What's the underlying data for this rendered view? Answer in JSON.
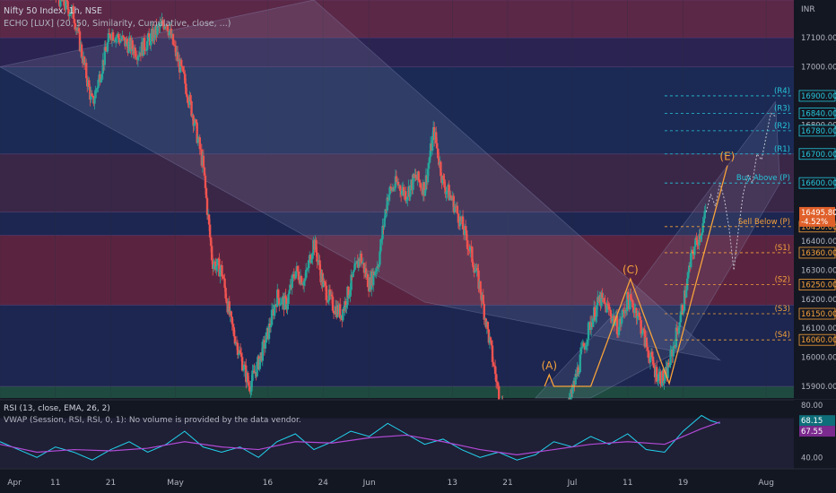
{
  "header": {
    "symbol_line": "Nifty 50 Index, 1h, NSE",
    "indicator_line": "ECHO [LUX] (20, 50, Similarity, Cumulative, close, ...)",
    "currency": "INR"
  },
  "rsi": {
    "title": "RSI (13, close, EMA, 26, 2)",
    "vwap_note": "VWAP (Session, RSI, RSI, 0, 1): No volume is provided by the data vendor.",
    "scale_labels": [
      "80.00",
      "40.00"
    ],
    "value_1": "68.15",
    "value_2": "67.55"
  },
  "colors": {
    "background": "#131722",
    "candle_up": "#26a69a",
    "candle_down": "#ef5350",
    "wave": "#f7a23b",
    "pivot_resistance": "#26c6da",
    "pivot_support": "#f7a23b",
    "rsi_line": "#22d3ee",
    "rsi_signal": "#b14ad6"
  },
  "chart_data": {
    "type": "candlestick",
    "title": "Nifty 50 Index, 1h, NSE",
    "ylim": [
      15860,
      17230
    ],
    "y_ticks": [
      17100,
      17000,
      16900,
      16800,
      16700,
      16600,
      16500,
      16400,
      16300,
      16200,
      16100,
      16000,
      15900
    ],
    "y_tick_labels": [
      "17100.00",
      "17000.00",
      "16900.00",
      "16800.00",
      "16700.00",
      "16600.00",
      "16500.00",
      "16400.00",
      "16300.00",
      "16200.00",
      "16100.00",
      "16000.00",
      "15900.00"
    ],
    "x_labels": [
      {
        "label": "Apr",
        "x": 0
      },
      {
        "label": "11",
        "x": 6
      },
      {
        "label": "21",
        "x": 12
      },
      {
        "label": "May",
        "x": 19
      },
      {
        "label": "16",
        "x": 29
      },
      {
        "label": "24",
        "x": 35
      },
      {
        "label": "Jun",
        "x": 40
      },
      {
        "label": "13",
        "x": 49
      },
      {
        "label": "21",
        "x": 55
      },
      {
        "label": "Jul",
        "x": 62
      },
      {
        "label": "11",
        "x": 68
      },
      {
        "label": "19",
        "x": 74
      },
      {
        "label": "Aug",
        "x": 83
      }
    ],
    "x_max": 86,
    "bands": [
      {
        "from": 17100,
        "to": 17230,
        "color": "#5b2848"
      },
      {
        "from": 17000,
        "to": 17100,
        "color": "#2b2452"
      },
      {
        "from": 16700,
        "to": 17000,
        "color": "#1b2a55"
      },
      {
        "from": 16500,
        "to": 16700,
        "color": "#3a2748"
      },
      {
        "from": 16420,
        "to": 16500,
        "color": "#1d2650"
      },
      {
        "from": 16180,
        "to": 16420,
        "color": "#5a2440"
      },
      {
        "from": 15900,
        "to": 16180,
        "color": "#1c2650"
      },
      {
        "from": 15860,
        "to": 15900,
        "color": "#1e4a40"
      }
    ],
    "price_series": [
      {
        "x": 0,
        "y": 17280
      },
      {
        "x": 3,
        "y": 17350
      },
      {
        "x": 6,
        "y": 17250
      },
      {
        "x": 8,
        "y": 17180
      },
      {
        "x": 10,
        "y": 16870
      },
      {
        "x": 12,
        "y": 17120
      },
      {
        "x": 15,
        "y": 17050
      },
      {
        "x": 18,
        "y": 17160
      },
      {
        "x": 19,
        "y": 17050
      },
      {
        "x": 20,
        "y": 16950
      },
      {
        "x": 21,
        "y": 16820
      },
      {
        "x": 22,
        "y": 16660
      },
      {
        "x": 23,
        "y": 16330
      },
      {
        "x": 24,
        "y": 16300
      },
      {
        "x": 25,
        "y": 16120
      },
      {
        "x": 26,
        "y": 16010
      },
      {
        "x": 27,
        "y": 15900
      },
      {
        "x": 28,
        "y": 15980
      },
      {
        "x": 29,
        "y": 16080
      },
      {
        "x": 30,
        "y": 16210
      },
      {
        "x": 31,
        "y": 16180
      },
      {
        "x": 32,
        "y": 16300
      },
      {
        "x": 33,
        "y": 16260
      },
      {
        "x": 34,
        "y": 16400
      },
      {
        "x": 35,
        "y": 16250
      },
      {
        "x": 36,
        "y": 16180
      },
      {
        "x": 37,
        "y": 16150
      },
      {
        "x": 38,
        "y": 16250
      },
      {
        "x": 39,
        "y": 16350
      },
      {
        "x": 40,
        "y": 16250
      },
      {
        "x": 41,
        "y": 16330
      },
      {
        "x": 42,
        "y": 16560
      },
      {
        "x": 43,
        "y": 16600
      },
      {
        "x": 44,
        "y": 16560
      },
      {
        "x": 45,
        "y": 16620
      },
      {
        "x": 46,
        "y": 16580
      },
      {
        "x": 47,
        "y": 16780
      },
      {
        "x": 48,
        "y": 16600
      },
      {
        "x": 49,
        "y": 16540
      },
      {
        "x": 50,
        "y": 16460
      },
      {
        "x": 51,
        "y": 16360
      },
      {
        "x": 52,
        "y": 16240
      },
      {
        "x": 53,
        "y": 16060
      },
      {
        "x": 54,
        "y": 15880
      },
      {
        "x": 55,
        "y": 15760
      },
      {
        "x": 56,
        "y": 15700
      },
      {
        "x": 57,
        "y": 15800
      },
      {
        "x": 58,
        "y": 15830
      },
      {
        "x": 59,
        "y": 15760
      },
      {
        "x": 60,
        "y": 15700
      },
      {
        "x": 61,
        "y": 15760
      },
      {
        "x": 62,
        "y": 15880
      },
      {
        "x": 63,
        "y": 16010
      },
      {
        "x": 64,
        "y": 16120
      },
      {
        "x": 65,
        "y": 16200
      },
      {
        "x": 66,
        "y": 16160
      },
      {
        "x": 67,
        "y": 16100
      },
      {
        "x": 68,
        "y": 16200
      },
      {
        "x": 69,
        "y": 16160
      },
      {
        "x": 70,
        "y": 16040
      },
      {
        "x": 71,
        "y": 15950
      },
      {
        "x": 72,
        "y": 15920
      },
      {
        "x": 73,
        "y": 16040
      },
      {
        "x": 74,
        "y": 16180
      },
      {
        "x": 75,
        "y": 16360
      },
      {
        "x": 76,
        "y": 16440
      },
      {
        "x": 76.5,
        "y": 16500
      }
    ],
    "echo_forecast": [
      {
        "x": 76.5,
        "y": 16500
      },
      {
        "x": 77,
        "y": 16560
      },
      {
        "x": 77.5,
        "y": 16520
      },
      {
        "x": 78,
        "y": 16600
      },
      {
        "x": 78.5,
        "y": 16540
      },
      {
        "x": 79,
        "y": 16440
      },
      {
        "x": 79.5,
        "y": 16300
      },
      {
        "x": 80,
        "y": 16440
      },
      {
        "x": 80.5,
        "y": 16560
      },
      {
        "x": 81,
        "y": 16630
      },
      {
        "x": 81.5,
        "y": 16600
      },
      {
        "x": 82,
        "y": 16700
      },
      {
        "x": 82.5,
        "y": 16680
      },
      {
        "x": 83,
        "y": 16760
      },
      {
        "x": 83.5,
        "y": 16840
      },
      {
        "x": 84,
        "y": 16830
      }
    ],
    "channels": [
      {
        "points": [
          [
            0,
            17000
          ],
          [
            46,
            16190
          ],
          [
            78,
            15990
          ],
          [
            34,
            17230
          ]
        ],
        "fill": "#9aa4c8",
        "opacity": 0.16
      },
      {
        "points": [
          [
            58,
            15860
          ],
          [
            68,
            16200
          ],
          [
            84,
            16880
          ],
          [
            84.5,
            16600
          ],
          [
            74,
            16030
          ],
          [
            64,
            15860
          ]
        ],
        "fill": "#9aa4c8",
        "opacity": 0.13
      }
    ],
    "wave_points": [
      {
        "x": 59,
        "y": 15900,
        "label": ""
      },
      {
        "x": 59.5,
        "y": 15940,
        "label": "(A)"
      },
      {
        "x": 60,
        "y": 15900,
        "label": ""
      },
      {
        "x": 64,
        "y": 15900,
        "label": ""
      },
      {
        "x": 68.3,
        "y": 16270,
        "label": "(C)"
      },
      {
        "x": 72.5,
        "y": 15910,
        "label": ""
      },
      {
        "x": 78.8,
        "y": 16660,
        "label": "(E)"
      }
    ],
    "pivot_lines": [
      {
        "label": "(R4)",
        "value": 16900,
        "value_label": "16900.00",
        "kind": "resistance"
      },
      {
        "label": "(R3)",
        "value": 16840,
        "value_label": "16840.00",
        "kind": "resistance"
      },
      {
        "label": "(R2)",
        "value": 16780,
        "value_label": "16780.00",
        "kind": "resistance"
      },
      {
        "label": "(R1)",
        "value": 16700,
        "value_label": "16700.00",
        "kind": "resistance"
      },
      {
        "label": "Buy Above (P)",
        "value": 16600,
        "value_label": "16600.00",
        "kind": "resistance"
      },
      {
        "label": "Sell Below (P)",
        "value": 16450,
        "value_label": "16450.00",
        "kind": "support"
      },
      {
        "label": "(S1)",
        "value": 16360,
        "value_label": "16360.00",
        "kind": "support"
      },
      {
        "label": "(S2)",
        "value": 16250,
        "value_label": "16250.00",
        "kind": "support"
      },
      {
        "label": "(S3)",
        "value": 16150,
        "value_label": "16150.00",
        "kind": "support"
      },
      {
        "label": "(S4)",
        "value": 16060,
        "value_label": "16060.00",
        "kind": "support"
      }
    ],
    "last_price": {
      "value": 16495.8,
      "label": "16495.80",
      "change": "-4.52%"
    },
    "rsi_series": [
      [
        0,
        52
      ],
      [
        2,
        46
      ],
      [
        4,
        40
      ],
      [
        6,
        48
      ],
      [
        8,
        44
      ],
      [
        10,
        38
      ],
      [
        12,
        46
      ],
      [
        14,
        52
      ],
      [
        16,
        44
      ],
      [
        18,
        50
      ],
      [
        20,
        60
      ],
      [
        21,
        54
      ],
      [
        22,
        48
      ],
      [
        24,
        44
      ],
      [
        26,
        48
      ],
      [
        28,
        40
      ],
      [
        30,
        52
      ],
      [
        32,
        58
      ],
      [
        34,
        46
      ],
      [
        36,
        52
      ],
      [
        38,
        60
      ],
      [
        40,
        56
      ],
      [
        42,
        66
      ],
      [
        44,
        58
      ],
      [
        46,
        50
      ],
      [
        48,
        54
      ],
      [
        50,
        46
      ],
      [
        52,
        40
      ],
      [
        54,
        44
      ],
      [
        56,
        38
      ],
      [
        58,
        42
      ],
      [
        60,
        52
      ],
      [
        62,
        48
      ],
      [
        64,
        56
      ],
      [
        66,
        50
      ],
      [
        68,
        58
      ],
      [
        70,
        46
      ],
      [
        72,
        44
      ],
      [
        74,
        60
      ],
      [
        76,
        72
      ],
      [
        77,
        68
      ],
      [
        78,
        66
      ]
    ],
    "rsi_signal_series": [
      [
        0,
        50
      ],
      [
        4,
        44
      ],
      [
        8,
        46
      ],
      [
        12,
        45
      ],
      [
        16,
        47
      ],
      [
        20,
        52
      ],
      [
        24,
        48
      ],
      [
        28,
        46
      ],
      [
        32,
        52
      ],
      [
        36,
        51
      ],
      [
        40,
        55
      ],
      [
        44,
        57
      ],
      [
        48,
        52
      ],
      [
        52,
        46
      ],
      [
        56,
        42
      ],
      [
        60,
        46
      ],
      [
        64,
        50
      ],
      [
        68,
        52
      ],
      [
        72,
        50
      ],
      [
        76,
        62
      ],
      [
        78,
        67
      ]
    ],
    "rsi_ylim": [
      32,
      84
    ]
  }
}
